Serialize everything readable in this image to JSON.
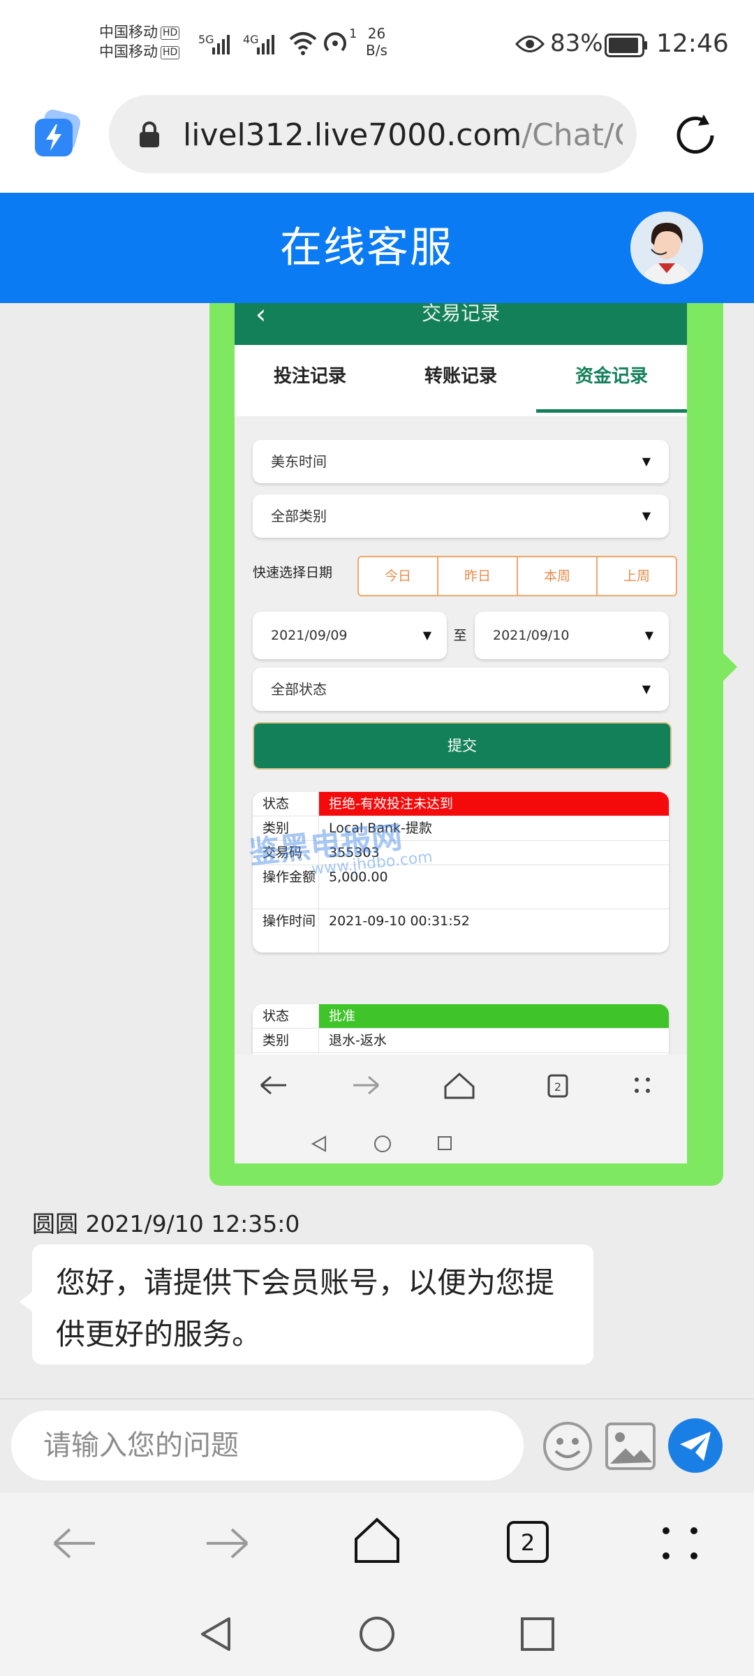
{
  "status_bar": {
    "carrier1": "中国移动",
    "carrier2": "中国移动",
    "hd": "HD",
    "net1": "5G",
    "net2": "4G",
    "hotspot_count": "1",
    "speed_value": "26",
    "speed_unit": "B/s",
    "battery": "83%",
    "time": "12:46"
  },
  "browser": {
    "url_host": "livel312.live7000.com",
    "url_path": "/Chat/C",
    "tab_count": "2"
  },
  "header": {
    "title": "在线客服"
  },
  "screenshot": {
    "title": "交易记录",
    "tabs": [
      "投注记录",
      "转账记录",
      "资金记录"
    ],
    "active_tab": 2,
    "select_timezone": "美东时间",
    "select_category": "全部类别",
    "quick_label": "快速选择日期",
    "quick_options": [
      "今日",
      "昨日",
      "本周",
      "上周"
    ],
    "date_from": "2021/09/09",
    "date_sep": "至",
    "date_to": "2021/09/10",
    "select_status": "全部状态",
    "submit": "提交",
    "record1": {
      "status_k": "状态",
      "status_v": "拒绝-有效投注未达到",
      "type_k": "类别",
      "type_v": "Local Bank-提款",
      "tx_k": "交易码",
      "tx_v": "355303",
      "amount_k": "操作金额",
      "amount_v": "5,000.00",
      "time_k": "操作时间",
      "time_v": "2021-09-10 00:31:52"
    },
    "record2": {
      "status_k": "状态",
      "status_v": "批准",
      "type_k": "类别",
      "type_v": "退水-返水"
    },
    "watermark": "鉴黑电报网",
    "watermark_url": "www.jhdbo.com",
    "tab_count": "2"
  },
  "message": {
    "sender": "圆圆",
    "timestamp": "2021/9/10 12:35:0",
    "text": "您好，请提供下会员账号，以便为您提供更好的服务。"
  },
  "input": {
    "placeholder": "请输入您的问题"
  },
  "colors": {
    "header_blue": "#0b7bf3",
    "bubble_green": "#7fe861",
    "screenshot_green": "#13805a",
    "send_blue": "#1a7fe5"
  }
}
